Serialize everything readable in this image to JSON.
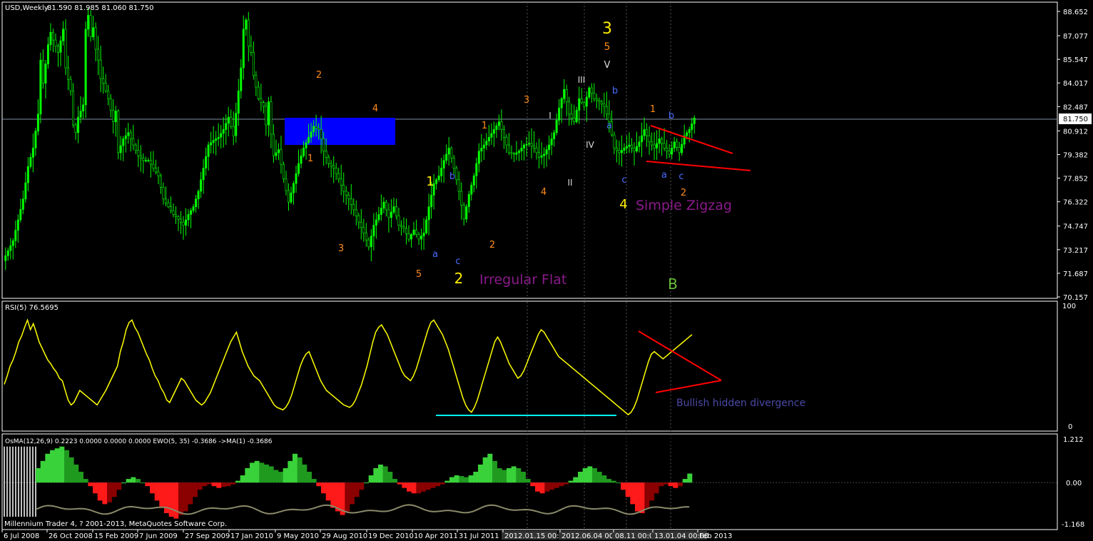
{
  "chart_data": {
    "type": "candlestick",
    "symbol_label": "USD,Weekly",
    "ohlc_label": "81.590 81.985 81.060 81.750",
    "current_price_label": "81.750",
    "footer": "Millennium Trader 4, ? 2001-2013, MetaQuotes Software Corp.",
    "colors": {
      "bull": "#00ff00",
      "bear": "#000000",
      "frame": "#ffffff",
      "rsi": "#ffff00",
      "trendline": "#ff0000",
      "support": "#00ffff",
      "box": "#0000ff",
      "hist_up": "#2ecc2e",
      "hist_down": "#ff0000",
      "osma": "#c0c0c0"
    },
    "price_axis": {
      "ylim": [
        70.157,
        88.652
      ],
      "ticks": [
        "88.652",
        "87.077",
        "85.547",
        "84.017",
        "82.487",
        "80.912",
        "79.382",
        "77.852",
        "76.322",
        "74.747",
        "73.217",
        "71.687",
        "70.157"
      ]
    },
    "date_axis": {
      "ticks": [
        "6 Jul 2008",
        "26 Oct 2008",
        "15 Feb 2009",
        "7 Jun 2009",
        "27 Sep 2009",
        "17 Jan 2010",
        "9 May 2010",
        "29 Aug 2010",
        "19 Dec 2010",
        "10 Apr 2011",
        "31 Jul 2011",
        "2012.01.15 00:00",
        "2012.06.04 00:00",
        "08.11 00:00",
        "13.01.04 00:00",
        "Feb 2013"
      ]
    },
    "price_series": [
      {
        "t": 0,
        "v": 72.5
      },
      {
        "t": 4,
        "v": 73.8
      },
      {
        "t": 8,
        "v": 76.5
      },
      {
        "t": 10,
        "v": 78.6
      },
      {
        "t": 12,
        "v": 79.8
      },
      {
        "t": 14,
        "v": 82.0
      },
      {
        "t": 15,
        "v": 85.5
      },
      {
        "t": 16,
        "v": 84.0
      },
      {
        "t": 18,
        "v": 86.5
      },
      {
        "t": 19,
        "v": 87.3
      },
      {
        "t": 20,
        "v": 86.8
      },
      {
        "t": 22,
        "v": 86.0
      },
      {
        "t": 24,
        "v": 87.5
      },
      {
        "t": 25,
        "v": 85.0
      },
      {
        "t": 27,
        "v": 83.5
      },
      {
        "t": 28,
        "v": 81.3
      },
      {
        "t": 29,
        "v": 80.8
      },
      {
        "t": 30,
        "v": 81.8
      },
      {
        "t": 32,
        "v": 82.6
      },
      {
        "t": 33,
        "v": 87.5
      },
      {
        "t": 34,
        "v": 88.4
      },
      {
        "t": 35,
        "v": 87.0
      },
      {
        "t": 36,
        "v": 87.6
      },
      {
        "t": 37,
        "v": 86.2
      },
      {
        "t": 38,
        "v": 85.5
      },
      {
        "t": 39,
        "v": 84.3
      },
      {
        "t": 40,
        "v": 84.0
      },
      {
        "t": 42,
        "v": 83.0
      },
      {
        "t": 44,
        "v": 81.5
      },
      {
        "t": 45,
        "v": 82.2
      },
      {
        "t": 46,
        "v": 79.5
      },
      {
        "t": 48,
        "v": 80.4
      },
      {
        "t": 50,
        "v": 80.8
      },
      {
        "t": 52,
        "v": 80.0
      },
      {
        "t": 54,
        "v": 79.3
      },
      {
        "t": 56,
        "v": 79.0
      },
      {
        "t": 58,
        "v": 79.0
      },
      {
        "t": 60,
        "v": 78.5
      },
      {
        "t": 62,
        "v": 78.0
      },
      {
        "t": 64,
        "v": 76.5
      },
      {
        "t": 66,
        "v": 76.0
      },
      {
        "t": 68,
        "v": 75.5
      },
      {
        "t": 70,
        "v": 75.2
      },
      {
        "t": 72,
        "v": 74.8
      },
      {
        "t": 74,
        "v": 75.5
      },
      {
        "t": 76,
        "v": 76.0
      },
      {
        "t": 78,
        "v": 77.0
      },
      {
        "t": 80,
        "v": 78.5
      },
      {
        "t": 82,
        "v": 80.0
      },
      {
        "t": 84,
        "v": 80.3
      },
      {
        "t": 86,
        "v": 80.5
      },
      {
        "t": 88,
        "v": 81.0
      },
      {
        "t": 90,
        "v": 81.8
      },
      {
        "t": 92,
        "v": 80.6
      },
      {
        "t": 94,
        "v": 83.5
      },
      {
        "t": 95,
        "v": 85.0
      },
      {
        "t": 96,
        "v": 87.5
      },
      {
        "t": 97,
        "v": 88.1
      },
      {
        "t": 98,
        "v": 86.4
      },
      {
        "t": 99,
        "v": 86.0
      },
      {
        "t": 100,
        "v": 84.5
      },
      {
        "t": 102,
        "v": 83.0
      },
      {
        "t": 104,
        "v": 82.5
      },
      {
        "t": 105,
        "v": 81.3
      },
      {
        "t": 106,
        "v": 82.8
      },
      {
        "t": 107,
        "v": 80.7
      },
      {
        "t": 108,
        "v": 79.3
      },
      {
        "t": 110,
        "v": 79.7
      },
      {
        "t": 112,
        "v": 77.8
      },
      {
        "t": 114,
        "v": 76.3
      },
      {
        "t": 116,
        "v": 77.5
      },
      {
        "t": 118,
        "v": 78.8
      },
      {
        "t": 120,
        "v": 79.8
      },
      {
        "t": 122,
        "v": 80.5
      },
      {
        "t": 124,
        "v": 81.2
      },
      {
        "t": 126,
        "v": 81.0
      },
      {
        "t": 127,
        "v": 80.4
      },
      {
        "t": 128,
        "v": 79.6
      },
      {
        "t": 130,
        "v": 78.8
      },
      {
        "t": 132,
        "v": 78.5
      },
      {
        "t": 134,
        "v": 77.8
      },
      {
        "t": 136,
        "v": 77.0
      },
      {
        "t": 138,
        "v": 76.5
      },
      {
        "t": 140,
        "v": 75.8
      },
      {
        "t": 142,
        "v": 75.0
      },
      {
        "t": 144,
        "v": 74.3
      },
      {
        "t": 146,
        "v": 73.4
      },
      {
        "t": 148,
        "v": 74.8
      },
      {
        "t": 150,
        "v": 75.5
      },
      {
        "t": 152,
        "v": 76.3
      },
      {
        "t": 154,
        "v": 75.3
      },
      {
        "t": 156,
        "v": 76.0
      },
      {
        "t": 158,
        "v": 74.8
      },
      {
        "t": 160,
        "v": 74.6
      },
      {
        "t": 162,
        "v": 73.9
      },
      {
        "t": 164,
        "v": 74.5
      },
      {
        "t": 166,
        "v": 73.9
      },
      {
        "t": 168,
        "v": 74.3
      },
      {
        "t": 170,
        "v": 76.0
      },
      {
        "t": 172,
        "v": 77.5
      },
      {
        "t": 174,
        "v": 78.0
      },
      {
        "t": 176,
        "v": 79.0
      },
      {
        "t": 178,
        "v": 79.8
      },
      {
        "t": 180,
        "v": 78.5
      },
      {
        "t": 182,
        "v": 77.0
      },
      {
        "t": 184,
        "v": 75.2
      },
      {
        "t": 186,
        "v": 76.8
      },
      {
        "t": 188,
        "v": 78.0
      },
      {
        "t": 190,
        "v": 79.6
      },
      {
        "t": 192,
        "v": 80.0
      },
      {
        "t": 194,
        "v": 80.5
      },
      {
        "t": 196,
        "v": 81.0
      },
      {
        "t": 198,
        "v": 81.5
      },
      {
        "t": 200,
        "v": 80.5
      },
      {
        "t": 202,
        "v": 79.5
      },
      {
        "t": 204,
        "v": 79.4
      },
      {
        "t": 206,
        "v": 79.6
      },
      {
        "t": 208,
        "v": 80.0
      },
      {
        "t": 210,
        "v": 80.1
      },
      {
        "t": 212,
        "v": 79.8
      },
      {
        "t": 214,
        "v": 79.2
      },
      {
        "t": 216,
        "v": 79.4
      },
      {
        "t": 218,
        "v": 80.0
      },
      {
        "t": 220,
        "v": 80.8
      },
      {
        "t": 222,
        "v": 82.4
      },
      {
        "t": 224,
        "v": 83.6
      },
      {
        "t": 226,
        "v": 82.0
      },
      {
        "t": 228,
        "v": 81.5
      },
      {
        "t": 230,
        "v": 83.0
      },
      {
        "t": 232,
        "v": 82.5
      },
      {
        "t": 234,
        "v": 83.7
      },
      {
        "t": 236,
        "v": 83.0
      },
      {
        "t": 238,
        "v": 82.8
      },
      {
        "t": 240,
        "v": 82.5
      },
      {
        "t": 242,
        "v": 81.5
      },
      {
        "t": 244,
        "v": 79.8
      },
      {
        "t": 246,
        "v": 79.5
      },
      {
        "t": 248,
        "v": 79.8
      },
      {
        "t": 250,
        "v": 80.0
      },
      {
        "t": 252,
        "v": 79.6
      },
      {
        "t": 254,
        "v": 80.2
      },
      {
        "t": 256,
        "v": 81.0
      },
      {
        "t": 258,
        "v": 80.2
      },
      {
        "t": 260,
        "v": 79.8
      },
      {
        "t": 262,
        "v": 80.4
      },
      {
        "t": 264,
        "v": 79.8
      },
      {
        "t": 266,
        "v": 79.4
      },
      {
        "t": 268,
        "v": 80.2
      },
      {
        "t": 270,
        "v": 79.5
      },
      {
        "t": 272,
        "v": 80.6
      },
      {
        "t": 274,
        "v": 81.0
      },
      {
        "t": 276,
        "v": 81.75
      }
    ],
    "rsi": {
      "label": "RSI(5) 76.5695",
      "ylim": [
        0,
        100
      ],
      "ticks": [
        "100",
        "0"
      ],
      "values": [
        35,
        42,
        50,
        55,
        62,
        70,
        75,
        82,
        88,
        80,
        85,
        78,
        70,
        65,
        60,
        55,
        52,
        48,
        45,
        40,
        38,
        30,
        22,
        18,
        20,
        25,
        30,
        28,
        26,
        24,
        22,
        20,
        18,
        22,
        26,
        30,
        35,
        40,
        45,
        50,
        62,
        70,
        80,
        86,
        88,
        82,
        78,
        72,
        66,
        60,
        55,
        48,
        42,
        38,
        32,
        28,
        22,
        20,
        25,
        30,
        35,
        40,
        38,
        34,
        30,
        26,
        22,
        20,
        18,
        20,
        24,
        28,
        34,
        40,
        46,
        52,
        58,
        64,
        70,
        74,
        78,
        70,
        62,
        56,
        50,
        46,
        42,
        40,
        38,
        34,
        30,
        26,
        22,
        18,
        16,
        15,
        14,
        16,
        20,
        26,
        34,
        42,
        50,
        56,
        60,
        62,
        56,
        50,
        44,
        38,
        34,
        30,
        28,
        26,
        24,
        22,
        20,
        18,
        17,
        16,
        18,
        22,
        28,
        34,
        42,
        50,
        60,
        70,
        78,
        82,
        84,
        80,
        76,
        70,
        64,
        58,
        52,
        46,
        42,
        40,
        38,
        42,
        48,
        56,
        64,
        72,
        80,
        86,
        88,
        84,
        80,
        76,
        70,
        64,
        56,
        48,
        40,
        32,
        24,
        18,
        14,
        12,
        16,
        22,
        30,
        38,
        46,
        54,
        62,
        70,
        74,
        70,
        64,
        58,
        52,
        48,
        44,
        40,
        42,
        46,
        52,
        58,
        64,
        70,
        76,
        80,
        78,
        74,
        70,
        66,
        62,
        58,
        56,
        54,
        52,
        50,
        48,
        46,
        44,
        42,
        40,
        38,
        36,
        34,
        32,
        30,
        28,
        26,
        24,
        22,
        20,
        18,
        16,
        14,
        12,
        10,
        12,
        16,
        22,
        30,
        38,
        46,
        54,
        60,
        62,
        60,
        58,
        56,
        58,
        60,
        62,
        64,
        66,
        68,
        70,
        72,
        74,
        76
      ]
    },
    "osma": {
      "label": "OsMA(12,26,9) 0.2223 0.0000 0.0000 0.0000  EWO(5, 35) -0.3686  ->MA(1) -0.3686",
      "ylim": [
        -1.168,
        1.212
      ],
      "ticks": [
        "1.212",
        "0.00",
        "-1.168"
      ],
      "values": [
        0.4,
        0.6,
        0.8,
        0.9,
        0.95,
        1.0,
        0.9,
        0.7,
        0.5,
        0.3,
        0.1,
        -0.1,
        -0.3,
        -0.5,
        -0.6,
        -0.55,
        -0.4,
        -0.2,
        0.0,
        0.1,
        0.15,
        0.1,
        0.0,
        -0.1,
        -0.3,
        -0.5,
        -0.7,
        -0.85,
        -0.95,
        -1.0,
        -0.9,
        -0.8,
        -0.6,
        -0.4,
        -0.2,
        -0.1,
        -0.05,
        -0.1,
        -0.15,
        -0.12,
        -0.1,
        -0.05,
        0.05,
        0.2,
        0.4,
        0.55,
        0.6,
        0.55,
        0.5,
        0.45,
        0.35,
        0.3,
        0.4,
        0.6,
        0.8,
        0.7,
        0.5,
        0.3,
        0.1,
        -0.1,
        -0.3,
        -0.5,
        -0.7,
        -0.8,
        -0.9,
        -0.8,
        -0.6,
        -0.4,
        -0.2,
        0.0,
        0.2,
        0.4,
        0.5,
        0.45,
        0.3,
        0.1,
        -0.05,
        -0.15,
        -0.25,
        -0.3,
        -0.3,
        -0.25,
        -0.2,
        -0.15,
        -0.1,
        -0.05,
        0.05,
        0.15,
        0.2,
        0.18,
        0.15,
        0.2,
        0.3,
        0.5,
        0.7,
        0.8,
        0.6,
        0.4,
        0.35,
        0.4,
        0.45,
        0.4,
        0.3,
        0.1,
        -0.1,
        -0.25,
        -0.3,
        -0.25,
        -0.2,
        -0.15,
        -0.1,
        -0.05,
        0.05,
        0.15,
        0.3,
        0.4,
        0.45,
        0.4,
        0.3,
        0.2,
        0.1,
        0.05,
        0.0,
        -0.2,
        -0.4,
        -0.6,
        -0.8,
        -0.85,
        -0.7,
        -0.5,
        -0.3,
        -0.1,
        -0.05,
        -0.1,
        -0.15,
        -0.1,
        0.1,
        0.25
      ]
    },
    "annotations": {
      "irregular_flat": "Irregular Flat",
      "simple_zigzag": "Simple Zigzag",
      "bullish_divergence": "Bullish hidden divergence",
      "wave_3": "3",
      "wave_5": "5",
      "wave_v": "V",
      "wave_2_orange_a": "2",
      "wave_4_orange_a": "4",
      "wave_1_orange_a": "1",
      "wave_3_orange_a": "3",
      "wave_5_orange": "5",
      "wave_1_yellow": "1",
      "wave_2_yellow": "2",
      "wave_4_yellow": "4",
      "wave_b_blue_a": "b",
      "wave_a_blue_a": "a",
      "wave_c_blue_a": "c",
      "wave_2_orange_b": "2",
      "wave_1_orange_b": "1",
      "wave_3_orange_b": "3",
      "wave_4_orange_b": "4",
      "wave_I": "I",
      "wave_II": "II",
      "wave_III": "III",
      "wave_IV": "IV",
      "wave_b_blue_b": "b",
      "wave_a_blue_b": "a",
      "wave_c_blue_b": "c",
      "wave_1_orange_c": "1",
      "wave_2_orange_c": "2",
      "wave_b_blue_c": "b",
      "wave_a_blue_c": "a",
      "wave_c_blue_c": "c",
      "wave_B": "B"
    }
  }
}
